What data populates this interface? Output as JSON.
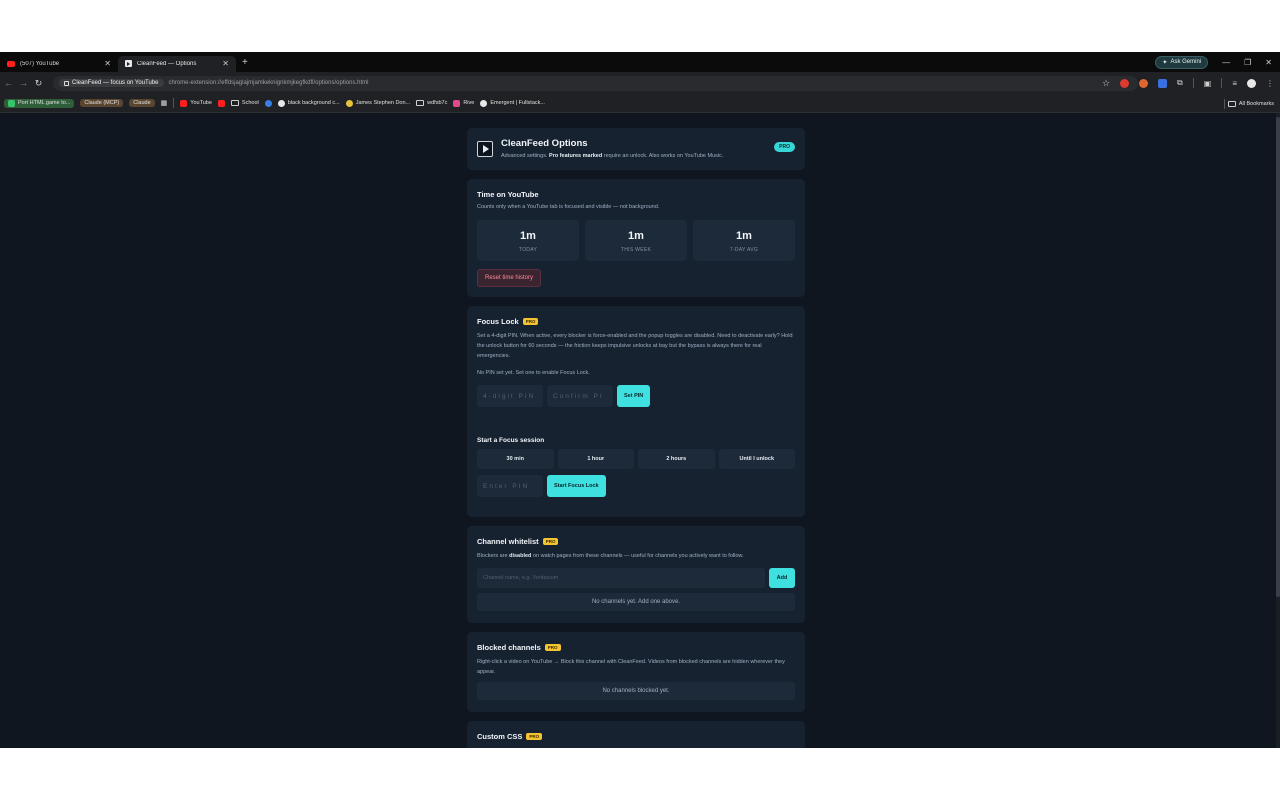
{
  "browser": {
    "tabs": [
      {
        "title": "(507) YouTube",
        "icon": "youtube-icon"
      },
      {
        "title": "CleanFeed — Options",
        "icon": "cleanfeed-icon"
      }
    ],
    "ask_gemini": "Ask Gemini",
    "site_chip": "CleanFeed — focus on YouTube",
    "url": "chrome-extension://effdsjaglajmjamkeknignkmjkegfkdfl/options/options.html",
    "bookmarks": [
      "Port HTML game to...",
      "Claude (MCP)",
      "Claude",
      "YouTube",
      "School",
      "black background c...",
      "James Stephen Don...",
      "wdfsb7c",
      "Rive",
      "Emergent | Fullstack..."
    ],
    "all_bookmarks": "All Bookmarks"
  },
  "header": {
    "title": "CleanFeed Options",
    "sub_pre": "Advanced settings.",
    "sub_bold": "Pro features marked",
    "sub_post": "require an unlock. Also works on YouTube Music.",
    "badge": "PRO"
  },
  "time": {
    "title": "Time on YouTube",
    "desc": "Counts only when a YouTube tab is focused and visible — not background.",
    "stats": [
      {
        "value": "1m",
        "label": "TODAY"
      },
      {
        "value": "1m",
        "label": "THIS WEEK"
      },
      {
        "value": "1m",
        "label": "7-DAY AVG"
      }
    ],
    "reset": "Reset time history"
  },
  "focus": {
    "title": "Focus Lock",
    "pro": "PRO",
    "desc": "Set a 4-digit PIN. When active, every blocker is force-enabled and the popup toggles are disabled. Need to deactivate early? Hold the unlock button for 60 seconds — the friction keeps impulsive unlocks at bay but the bypass is always there for real emergencies.",
    "status": "No PIN set yet. Set one to enable Focus Lock.",
    "pin_placeholder": "4-digit PIN",
    "confirm_placeholder": "Confirm PI",
    "set_pin": "Set PIN",
    "session_label": "Start a Focus session",
    "durations": [
      "30 min",
      "1 hour",
      "2 hours",
      "Until I unlock"
    ],
    "enter_pin": "Enter PIN",
    "start": "Start Focus Lock"
  },
  "whitelist": {
    "title": "Channel whitelist",
    "pro": "PRO",
    "desc_pre": "Blockers are",
    "desc_bold": "disabled",
    "desc_post": "on watch pages from these channels — useful for channels you actively want to follow.",
    "placeholder": "Channel name, e.g. Veritasium",
    "add": "Add",
    "empty": "No channels yet. Add one above."
  },
  "blocked": {
    "title": "Blocked channels",
    "pro": "PRO",
    "desc": "Right-click a video on YouTube → Block this channel with CleanFeed. Videos from blocked channels are hidden wherever they appear.",
    "empty": "No channels blocked yet."
  },
  "css": {
    "title": "Custom CSS",
    "pro": "PRO"
  }
}
